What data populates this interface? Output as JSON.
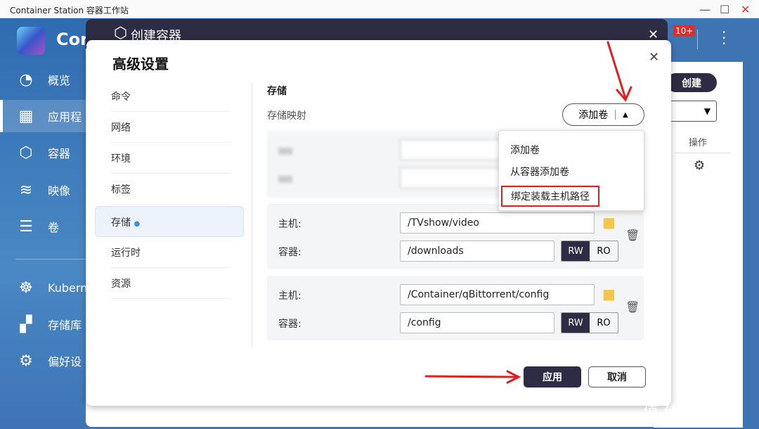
{
  "window": {
    "title": "Container Station 容器工作站",
    "minimize": "—",
    "maximize": "☐",
    "close": "✕"
  },
  "sidebar": {
    "brand": "Con",
    "items": [
      {
        "label": "概览",
        "icon": "gauge-icon"
      },
      {
        "label": "应用程",
        "icon": "apps-icon"
      },
      {
        "label": "容器",
        "icon": "cube-icon"
      },
      {
        "label": "映像",
        "icon": "layers-icon"
      },
      {
        "label": "卷",
        "icon": "database-icon"
      },
      {
        "label": "Kubern",
        "icon": "helm-icon"
      },
      {
        "label": "存储库",
        "icon": "repository-icon"
      },
      {
        "label": "偏好设",
        "icon": "settings-icon"
      }
    ]
  },
  "background": {
    "notification_badge": "10+",
    "create_button": "创建",
    "column_action": "操作"
  },
  "create_dialog": {
    "title": "创建容器"
  },
  "advanced": {
    "title": "高级设置",
    "nav": [
      {
        "label": "命令"
      },
      {
        "label": "网络"
      },
      {
        "label": "环境"
      },
      {
        "label": "标签"
      },
      {
        "label": "存储",
        "selected": true
      },
      {
        "label": "运行时"
      },
      {
        "label": "资源"
      }
    ],
    "section_title": "存储",
    "mapping_label": "存储映射",
    "add_volume_button": "添加卷",
    "dropdown": [
      "添加卷",
      "从容器添加卷",
      "绑定装载主机路径"
    ],
    "mappings": [
      {
        "host_label": "主机:",
        "host": "/TVshow/video",
        "container_label": "容器:",
        "container": "/downloads",
        "mode": "RW",
        "modes": [
          "RW",
          "RO"
        ]
      },
      {
        "host_label": "主机:",
        "host": "/Container/qBittorrent/config",
        "container_label": "容器:",
        "container": "/config",
        "mode": "RW",
        "modes": [
          "RW",
          "RO"
        ]
      }
    ],
    "apply_button": "应用",
    "cancel_button": "取消"
  },
  "watermark": "值 什么值得买",
  "colors": {
    "dark": "#2e2b44",
    "sidebar": "#3f74b3",
    "highlight": "#e02020",
    "badge": "#d9302c"
  }
}
